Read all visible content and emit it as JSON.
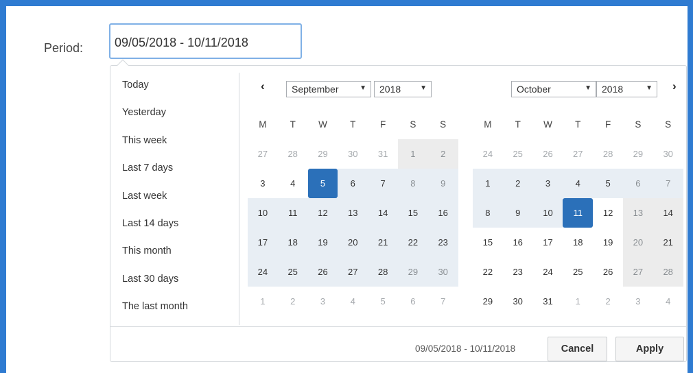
{
  "period": {
    "label": "Period:",
    "value": "09/05/2018 - 10/11/2018"
  },
  "ranges": [
    "Today",
    "Yesterday",
    "This week",
    "Last 7 days",
    "Last week",
    "Last 14 days",
    "This month",
    "Last 30 days",
    "The last month"
  ],
  "weekdays": [
    "M",
    "T",
    "W",
    "T",
    "F",
    "S",
    "S"
  ],
  "left_calendar": {
    "month": "September",
    "year": "2018",
    "weeks": [
      [
        "27",
        "28",
        "29",
        "30",
        "31",
        "1",
        "2"
      ],
      [
        "3",
        "4",
        "5",
        "6",
        "7",
        "8",
        "9"
      ],
      [
        "10",
        "11",
        "12",
        "13",
        "14",
        "15",
        "16"
      ],
      [
        "17",
        "18",
        "19",
        "20",
        "21",
        "22",
        "23"
      ],
      [
        "24",
        "25",
        "26",
        "27",
        "28",
        "29",
        "30"
      ],
      [
        "1",
        "2",
        "3",
        "4",
        "5",
        "6",
        "7"
      ]
    ]
  },
  "right_calendar": {
    "month": "October",
    "year": "2018",
    "weeks": [
      [
        "24",
        "25",
        "26",
        "27",
        "28",
        "29",
        "30"
      ],
      [
        "1",
        "2",
        "3",
        "4",
        "5",
        "6",
        "7"
      ],
      [
        "8",
        "9",
        "10",
        "11",
        "12",
        "13",
        "14"
      ],
      [
        "15",
        "16",
        "17",
        "18",
        "19",
        "20",
        "21"
      ],
      [
        "22",
        "23",
        "24",
        "25",
        "26",
        "27",
        "28"
      ],
      [
        "29",
        "30",
        "31",
        "1",
        "2",
        "3",
        "4"
      ]
    ]
  },
  "nav": {
    "prev": "‹",
    "next": "›",
    "dropdown_arrow": "▼"
  },
  "footer": {
    "range_text": "09/05/2018 - 10/11/2018",
    "cancel": "Cancel",
    "apply": "Apply"
  },
  "colors": {
    "selected": "#2b70b9",
    "range": "#e8eef4",
    "weekend_bg": "#ececec",
    "background": "#2f7bd1"
  }
}
